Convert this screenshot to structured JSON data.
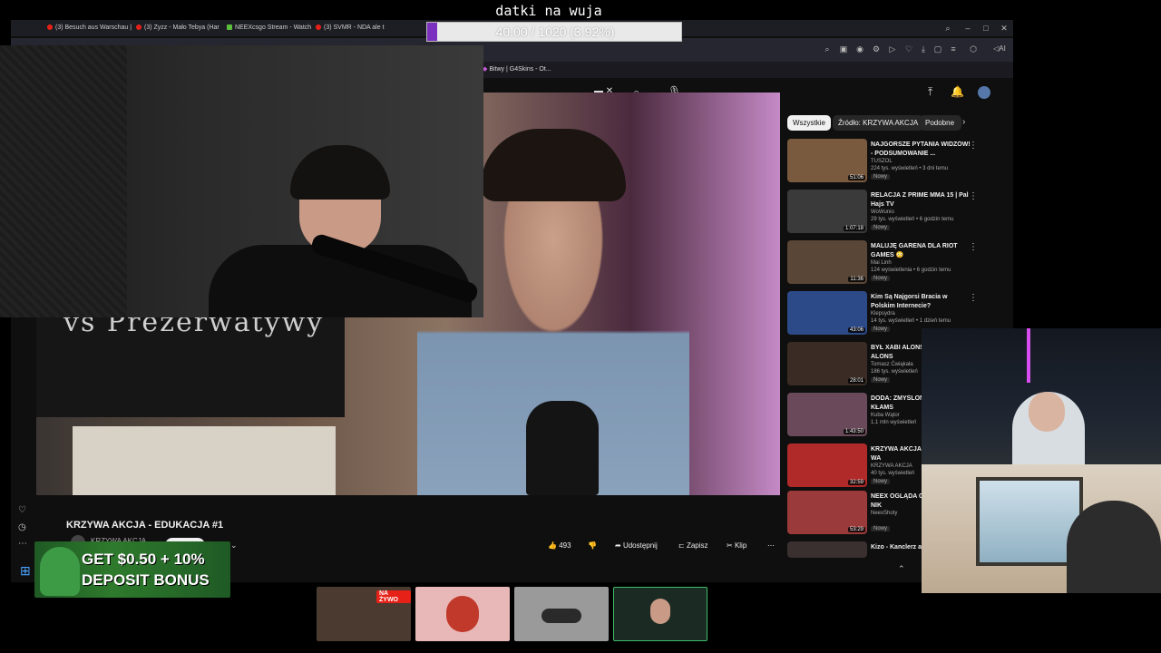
{
  "stream_overlay": {
    "donation_label": "datki na wuja",
    "donation_progress_text": "40.00 / 1020 (3.92%)",
    "donation_progress_fraction": 0.0392,
    "fill_color": "#7b2fbf"
  },
  "browser": {
    "tabs": [
      {
        "label": "(3) Besuch aus Warschau |"
      },
      {
        "label": "(3) Zyzz - Mało Tebya (Har"
      },
      {
        "label": "NEEXcsgo Stream - Watch"
      },
      {
        "label": "(3) SVMR - NDA ale t"
      }
    ],
    "bookmark": "Bitwy | G4Skins - Ot...",
    "toolbar_icons": [
      "search-icon",
      "screenshot-icon",
      "camera-icon",
      "settings-icon",
      "play-icon",
      "heart-icon",
      "download-icon",
      "lock-icon",
      "menu-icon",
      "extension-icon",
      "ai-icon"
    ],
    "ai_label": "AI"
  },
  "youtube": {
    "video_title": "KRZYWA AKCJA - EDUKACJA #1",
    "channel": "KRZYWA AKCJA",
    "board_text": "vs Prezerwatywy",
    "like_count": "493",
    "share_label": "Udostępnij",
    "save_label": "Zapisz",
    "clip_label": "Klip",
    "chips": [
      "Wszystkie",
      "Źródło: KRZYWA AKCJA",
      "Podobne"
    ],
    "recommendations": [
      {
        "title": "NAJGORSZE PYTANIA WIDZÓW! - PODSUMOWANIE ...",
        "channel": "TUSZOL",
        "meta": "224 tys. wyświetleń • 3 dni temu",
        "badge": "Nowy",
        "duration": "51:06",
        "color": "#7a5a3e"
      },
      {
        "title": "RELACJA Z PRIME MMA 15 | Pal Hajs TV",
        "channel": "WoWunio",
        "meta": "29 tys. wyświetleń • 6 godzin temu",
        "badge": "Nowy",
        "duration": "1:07:18",
        "color": "#3b3a3a"
      },
      {
        "title": "MALUJĘ GARENA DLA RIOT GAMES 😳",
        "channel": "Mai Linh",
        "meta": "124 wyświetlenia • 6 godzin temu",
        "badge": "Nowy",
        "duration": "11:36",
        "color": "#5a4636"
      },
      {
        "title": "Kim Są Najgorsi Bracia w Polskim Internecie?",
        "channel": "Klepsydra",
        "meta": "14 tys. wyświetleń • 1 dzień temu",
        "badge": "Nowy",
        "duration": "43:06",
        "color": "#2d4a88"
      },
      {
        "title": "BYŁ XABI ALONS XABIEGO ALONS",
        "channel": "Tomasz Ćwiąkała",
        "meta": "186 tys. wyświetleń",
        "badge": "Nowy",
        "duration": "28:01",
        "color": "#3a2c24"
      },
      {
        "title": "DODA: ZMYŚLON KARIERA. KŁAMS",
        "channel": "Kuba Wątor",
        "meta": "1,1 mln wyświetleń",
        "badge": "",
        "duration": "1:43:50",
        "color": "#6a4a5a"
      },
      {
        "title": "KRZYWA AKCJA FRANCUSKIE WA",
        "channel": "KRZYWA AKCJA",
        "meta": "40 tys. wyświetleń",
        "badge": "Nowy",
        "duration": "32:59",
        "color": "#b02a2a"
      },
      {
        "title": "NEEX OGLĄDA CI UNIWERSUM NIK",
        "channel": "NeexShoty",
        "meta": "",
        "badge": "Nowy",
        "duration": "53:29",
        "color": "#9a3a3a"
      },
      {
        "title": "Kizo - Kanclerz al S&M",
        "channel": "",
        "meta": "",
        "badge": "",
        "duration": "",
        "color": "#3a3030"
      }
    ]
  },
  "ad": {
    "line1": "GET $0.50 + 10%",
    "line2": "DEPOSIT BONUS"
  },
  "taskbar": {
    "live_label": "NA ŻYWO",
    "thumbs": [
      {
        "name": "stream-preview-1",
        "color": "#4a3a30"
      },
      {
        "name": "stream-preview-2",
        "color": "#e8b8b8"
      },
      {
        "name": "stream-preview-3",
        "color": "#9a9a9a"
      },
      {
        "name": "stream-preview-4",
        "color": "#1b2a22"
      }
    ]
  }
}
